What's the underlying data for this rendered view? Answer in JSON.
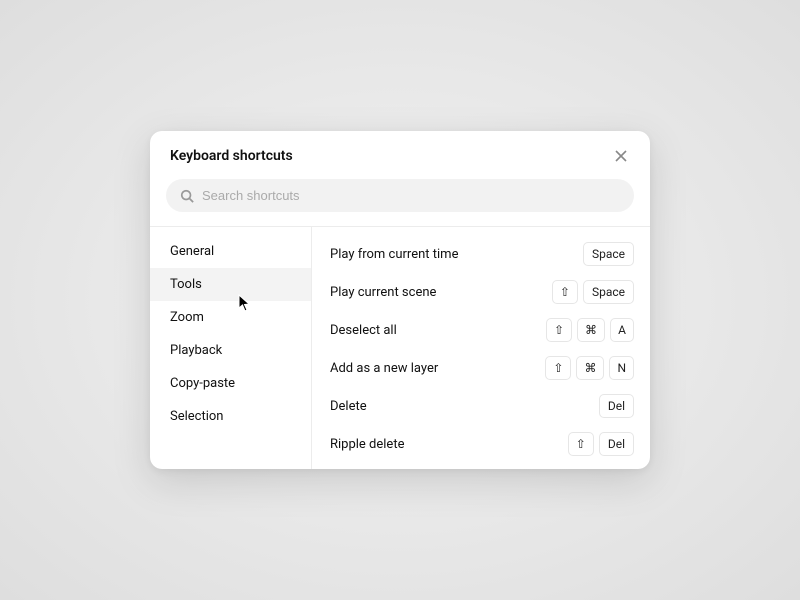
{
  "header": {
    "title": "Keyboard shortcuts"
  },
  "search": {
    "placeholder": "Search shortcuts"
  },
  "categories": [
    {
      "label": "General"
    },
    {
      "label": "Tools"
    },
    {
      "label": "Zoom"
    },
    {
      "label": "Playback"
    },
    {
      "label": "Copy-paste"
    },
    {
      "label": "Selection"
    }
  ],
  "active_category_index": 1,
  "shortcuts": [
    {
      "label": "Play from current time",
      "keys": [
        "Space"
      ]
    },
    {
      "label": "Play current scene",
      "keys": [
        "⇧",
        "Space"
      ]
    },
    {
      "label": "Deselect all",
      "keys": [
        "⇧",
        "⌘",
        "A"
      ]
    },
    {
      "label": "Add as a new layer",
      "keys": [
        "⇧",
        "⌘",
        "N"
      ]
    },
    {
      "label": "Delete",
      "keys": [
        "Del"
      ]
    },
    {
      "label": "Ripple delete",
      "keys": [
        "⇧",
        "Del"
      ]
    }
  ]
}
